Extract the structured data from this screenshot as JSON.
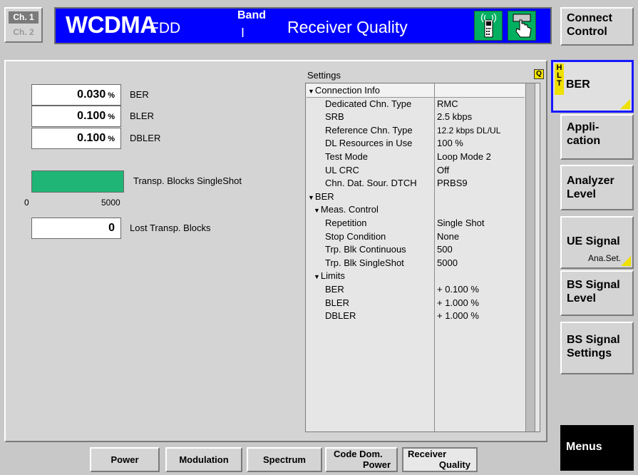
{
  "header": {
    "ch1": "Ch. 1",
    "ch2": "Ch. 2",
    "system": "WCDMA",
    "mode": "FDD",
    "band_label": "Band",
    "band_value": "I",
    "measurement": "Receiver Quality"
  },
  "results": {
    "ber": {
      "value": "0.030",
      "unit": "%",
      "label": "BER"
    },
    "bler": {
      "value": "0.100",
      "unit": "%",
      "label": "BLER"
    },
    "dbler": {
      "value": "0.100",
      "unit": "%",
      "label": "DBLER"
    },
    "progress": {
      "label": "Transp. Blocks SingleShot",
      "fraction": 1.0,
      "axis_min": "0",
      "axis_max": "5000"
    },
    "lost": {
      "value": "0",
      "label": "Lost Transp. Blocks"
    }
  },
  "settings": {
    "title": "Settings",
    "rows": [
      {
        "name": "Connection Info",
        "value": "",
        "indent": 0,
        "arrow": true
      },
      {
        "name": "Dedicated Chn. Type",
        "value": "RMC",
        "indent": 2,
        "arrow": false
      },
      {
        "name": "SRB",
        "value": "2.5 kbps",
        "indent": 2,
        "arrow": false
      },
      {
        "name": "Reference Chn. Type",
        "value": "12.2 kbps DL/UL",
        "indent": 2,
        "arrow": false
      },
      {
        "name": "DL Resources in Use",
        "value": "100 %",
        "indent": 2,
        "arrow": false
      },
      {
        "name": "Test Mode",
        "value": "Loop Mode 2",
        "indent": 2,
        "arrow": false
      },
      {
        "name": "UL CRC",
        "value": "Off",
        "indent": 2,
        "arrow": false
      },
      {
        "name": "Chn. Dat. Sour. DTCH",
        "value": "PRBS9",
        "indent": 2,
        "arrow": false
      },
      {
        "name": "BER",
        "value": "",
        "indent": 0,
        "arrow": true
      },
      {
        "name": "Meas. Control",
        "value": "",
        "indent": 1,
        "arrow": true
      },
      {
        "name": "Repetition",
        "value": "Single Shot",
        "indent": 2,
        "arrow": false
      },
      {
        "name": "Stop Condition",
        "value": "None",
        "indent": 2,
        "arrow": false
      },
      {
        "name": "Trp. Blk Continuous",
        "value": "500",
        "indent": 2,
        "arrow": false
      },
      {
        "name": "Trp. Blk SingleShot",
        "value": "5000",
        "indent": 2,
        "arrow": false
      },
      {
        "name": "Limits",
        "value": "",
        "indent": 1,
        "arrow": true
      },
      {
        "name": "BER",
        "value": "+ 0.100  %",
        "indent": 2,
        "arrow": false
      },
      {
        "name": "BLER",
        "value": "+ 1.000  %",
        "indent": 2,
        "arrow": false
      },
      {
        "name": "DBLER",
        "value": "+ 1.000  %",
        "indent": 2,
        "arrow": false
      }
    ]
  },
  "softkeys": {
    "connect_control": [
      "Connect",
      "Control"
    ],
    "hlt": [
      "H",
      "L",
      "T"
    ],
    "ber": "BER",
    "application": [
      "Appli-",
      "cation"
    ],
    "analyzer_level": [
      "Analyzer",
      "Level"
    ],
    "ue_signal": "UE Signal",
    "ue_signal_sub": "Ana.Set.",
    "bs_signal_level": [
      "BS Signal",
      "Level"
    ],
    "bs_signal_settings": [
      "BS Signal",
      "Settings"
    ],
    "menus": "Menus"
  },
  "tabs": {
    "power": "Power",
    "modulation": "Modulation",
    "spectrum": "Spectrum",
    "code_dom": [
      "Code Dom.",
      "Power"
    ],
    "receiver": [
      "Receiver",
      "Quality"
    ]
  },
  "colors": {
    "title_bg": "#0000ff",
    "progress_fill": "#1fb576",
    "highlight_yellow": "#f0e000",
    "active_border": "#1818ff"
  }
}
